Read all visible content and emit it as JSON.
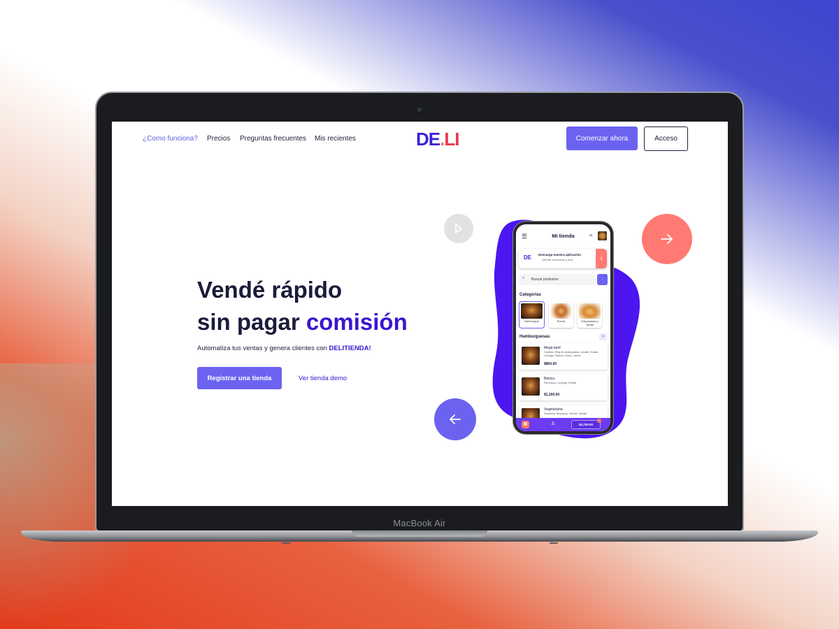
{
  "device": {
    "label": "MacBook Air"
  },
  "nav": {
    "links": [
      "¿Como funciona?",
      "Precios",
      "Preguntas frecuentes",
      "Mis recientes"
    ],
    "logo": {
      "part1": "DE",
      "dot": ".",
      "part2": "LI"
    },
    "start_button": "Comenzar ahora",
    "login_button": "Acceso"
  },
  "hero": {
    "title_line1": "Vendé rápido",
    "title_line2_a": "sin pagar ",
    "title_line2_b": "comisión",
    "subtitle": "Automatiza tus ventas y genera clientes con ",
    "subtitle_brand": "DELITIENDA!",
    "register_button": "Registrar una tienda",
    "demo_link": "Ver tienda demo"
  },
  "controls": {
    "play_icon": "play-icon",
    "next_icon": "arrow-right-icon",
    "prev_icon": "arrow-left-icon"
  },
  "colors": {
    "primary": "#6b63f0",
    "brand_purple": "#3b16d0",
    "coral": "#ff7a73"
  },
  "phone": {
    "title": "Mi tienda",
    "banner": {
      "logo": "DE",
      "title": "Descarga nuestra aplicación",
      "subtitle": "Ofertas exclusivas y mas"
    },
    "search_placeholder": "Buscar productos",
    "categories_title": "Categorías",
    "categories": [
      {
        "label": "Hamburgue"
      },
      {
        "label": "Pizzas"
      },
      {
        "label": "Empanadas y Tartas"
      }
    ],
    "products_title": "Hamburguesas",
    "products": [
      {
        "name": "Mega beef",
        "desc": "Cheddar, 250g de hamburguesa, Cebolla, Tomate, Lechuga, Pepinos, Huevo, Jamon",
        "price": "$800.00"
      },
      {
        "name": "Basica",
        "desc": "Pan blanco, Lechuga, Tomate",
        "price": "$1,200.00"
      },
      {
        "name": "Vegetariana",
        "desc": "Zanahoria, Berenjena, Cebolla, Tomate",
        "price": ""
      }
    ],
    "cart_total": "$4,700.00"
  }
}
